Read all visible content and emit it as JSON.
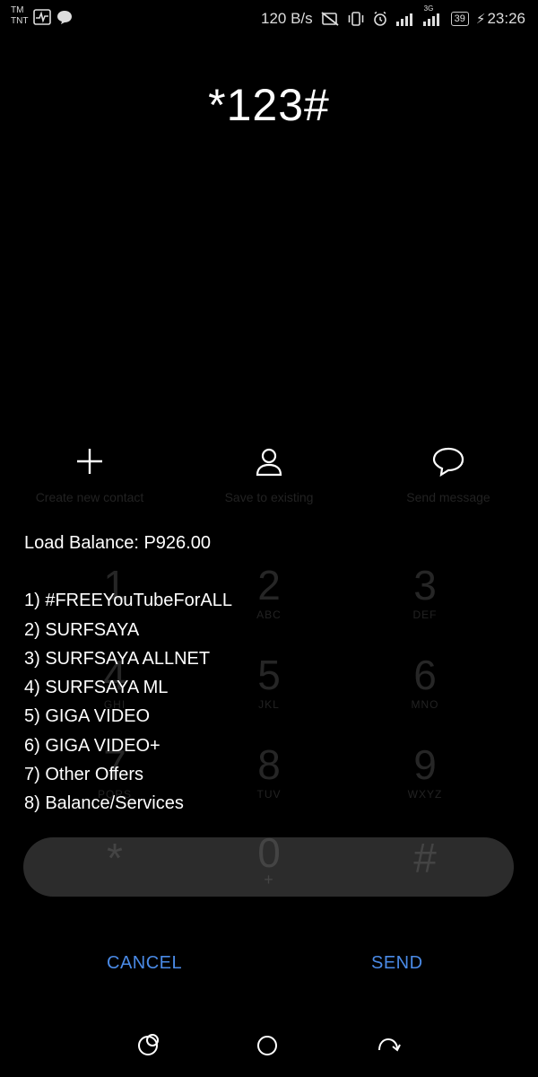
{
  "status_bar": {
    "carrier_line1": "TM",
    "carrier_line2": "TNT",
    "net_speed": "120 B/s",
    "network_type": "3G",
    "battery_level": "39",
    "time": "23:26"
  },
  "dialer": {
    "number": "*123#",
    "actions": [
      {
        "label": "Create new contact",
        "icon": "plus-icon"
      },
      {
        "label": "Save to existing",
        "icon": "person-icon"
      },
      {
        "label": "Send message",
        "icon": "chat-bubble-icon"
      }
    ],
    "keys": [
      {
        "digit": "1",
        "letters": ""
      },
      {
        "digit": "2",
        "letters": "ABC"
      },
      {
        "digit": "3",
        "letters": "DEF"
      },
      {
        "digit": "4",
        "letters": "GHI"
      },
      {
        "digit": "5",
        "letters": "JKL"
      },
      {
        "digit": "6",
        "letters": "MNO"
      },
      {
        "digit": "7",
        "letters": "PQRS"
      },
      {
        "digit": "8",
        "letters": "TUV"
      },
      {
        "digit": "9",
        "letters": "WXYZ"
      },
      {
        "digit": "*",
        "letters": ""
      },
      {
        "digit": "0",
        "letters": "+"
      },
      {
        "digit": "#",
        "letters": ""
      }
    ]
  },
  "ussd_dialog": {
    "balance_line": "Load Balance: P926.00",
    "options": [
      "1) #FREEYouTubeForALL",
      "2) SURFSAYA",
      "3) SURFSAYA ALLNET",
      "4) SURFSAYA ML",
      "5) GIGA VIDEO",
      "6) GIGA VIDEO+",
      "7) Other Offers",
      "8) Balance/Services"
    ],
    "cancel_label": "CANCEL",
    "send_label": "SEND"
  },
  "colors": {
    "background": "#000000",
    "accent": "#4a8ae6",
    "text": "#ffffff",
    "input_bar": "#2c2c2c"
  }
}
